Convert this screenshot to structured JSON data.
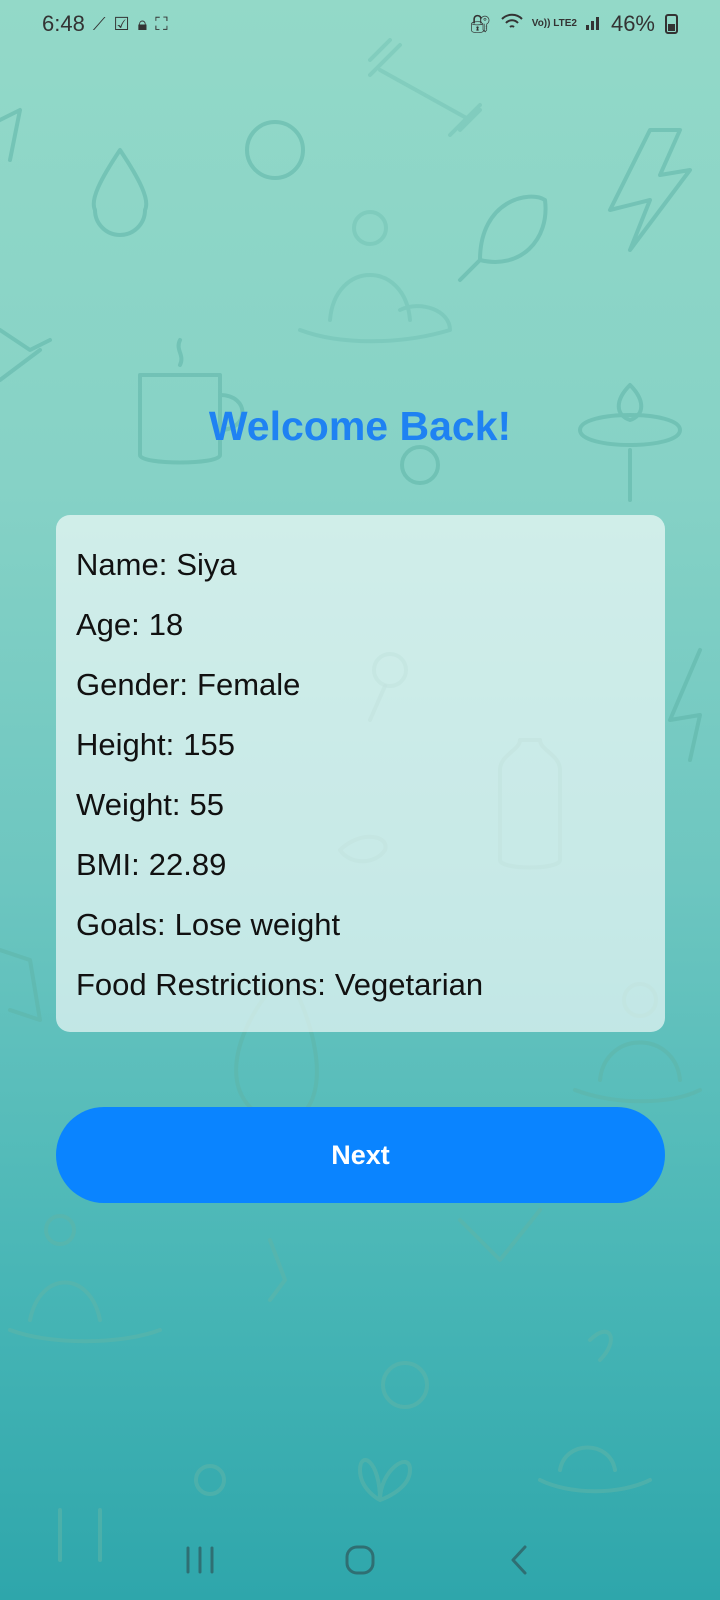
{
  "status_bar": {
    "time": "6:48",
    "battery": "46%",
    "network_label": "Vo)) LTE2"
  },
  "screen": {
    "title": "Welcome Back!"
  },
  "profile": {
    "rows": [
      {
        "label": "Name:",
        "value": "Siya"
      },
      {
        "label": "Age:",
        "value": "18"
      },
      {
        "label": "Gender:",
        "value": "Female"
      },
      {
        "label": "Height:",
        "value": "155"
      },
      {
        "label": "Weight:",
        "value": "55"
      },
      {
        "label": "BMI:",
        "value": "22.89"
      },
      {
        "label": "Goals:",
        "value": "Lose weight"
      },
      {
        "label": "Food Restrictions:",
        "value": "Vegetarian"
      }
    ]
  },
  "actions": {
    "next_label": "Next"
  },
  "colors": {
    "accent": "#0a84ff",
    "title": "#1f82f2",
    "background_top": "#93d9c8",
    "background_bottom": "#2ea6ab"
  },
  "icons": [
    "magic-wand-icon",
    "checkbox-icon",
    "lock-icon",
    "screenshot-icon",
    "vpn-icon",
    "wifi-icon",
    "signal-icon",
    "battery-icon",
    "recents-icon",
    "home-icon",
    "back-icon"
  ]
}
